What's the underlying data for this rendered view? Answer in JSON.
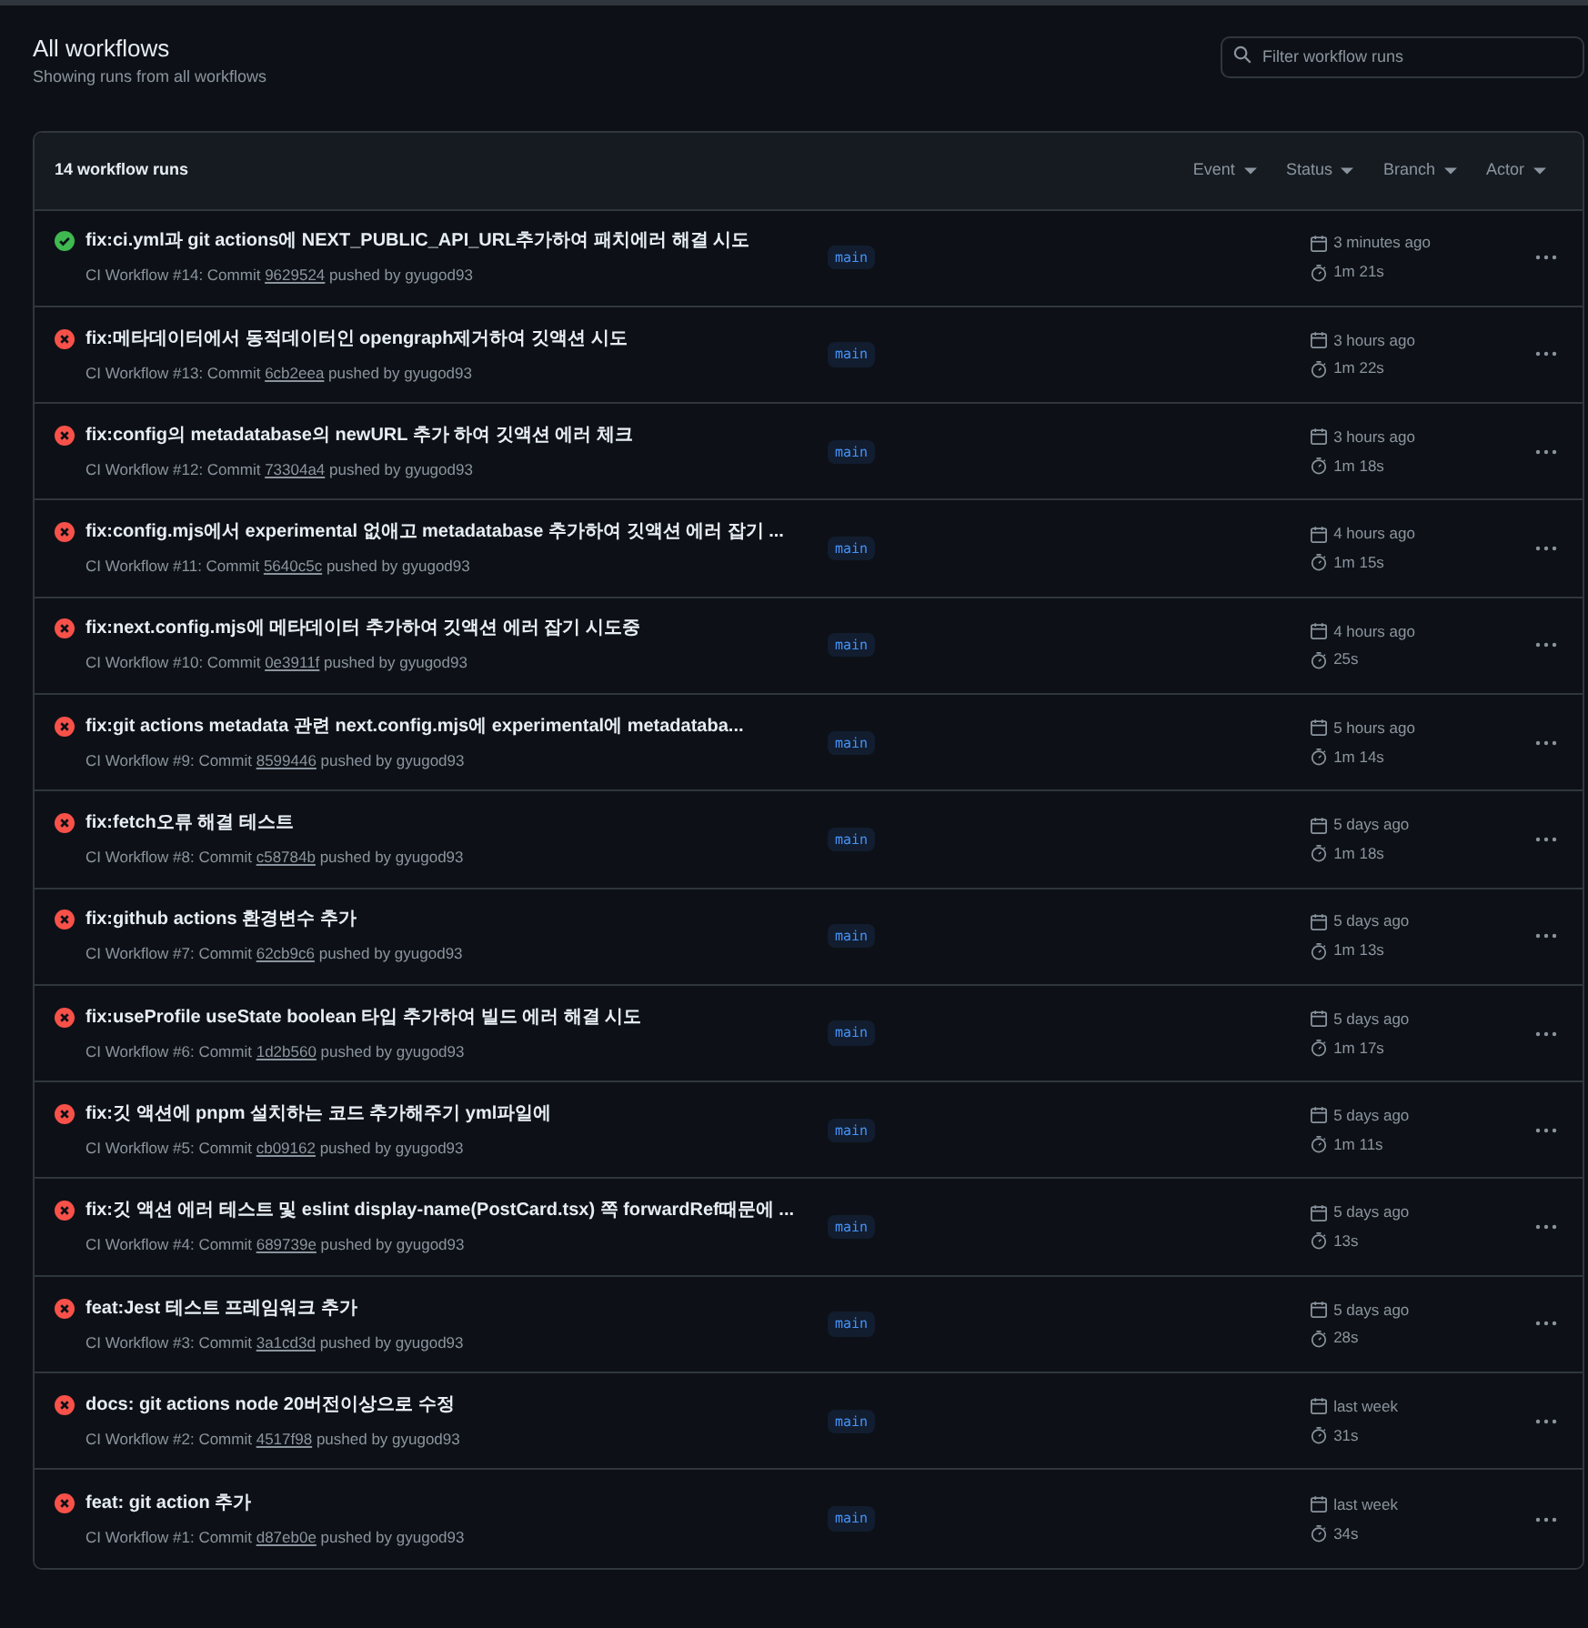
{
  "header": {
    "title": "All workflows",
    "subtitle": "Showing runs from all workflows"
  },
  "search": {
    "placeholder": "Filter workflow runs"
  },
  "runs_header": {
    "count": "14 workflow runs",
    "filters": [
      "Event",
      "Status",
      "Branch",
      "Actor"
    ]
  },
  "runs": [
    {
      "kind": "success",
      "title": "fix:ci.yml과 git actions에 NEXT_PUBLIC_API_URL추가하여 패치에러 해결 시도",
      "workflow": "CI Workflow #14: Commit ",
      "commit": "9629524",
      "actor": " pushed by gyugod93",
      "branch": "main",
      "time": "3 minutes ago",
      "duration": "1m 21s"
    },
    {
      "kind": "failure",
      "title": "fix:메타데이터에서 동적데이터인 opengraph제거하여 깃액션 시도",
      "workflow": "CI Workflow #13: Commit ",
      "commit": "6cb2eea",
      "actor": " pushed by gyugod93",
      "branch": "main",
      "time": "3 hours ago",
      "duration": "1m 22s"
    },
    {
      "kind": "failure",
      "title": "fix:config의 metadatabase의 newURL 추가 하여 깃액션 에러 체크",
      "workflow": "CI Workflow #12: Commit ",
      "commit": "73304a4",
      "actor": " pushed by gyugod93",
      "branch": "main",
      "time": "3 hours ago",
      "duration": "1m 18s"
    },
    {
      "kind": "failure",
      "title": "fix:config.mjs에서 experimental 없애고 metadatabase 추가하여 깃액션 에러 잡기 ...",
      "workflow": "CI Workflow #11: Commit ",
      "commit": "5640c5c",
      "actor": " pushed by gyugod93",
      "branch": "main",
      "time": "4 hours ago",
      "duration": "1m 15s"
    },
    {
      "kind": "failure",
      "title": "fix:next.config.mjs에 메타데이터 추가하여 깃액션 에러 잡기 시도중",
      "workflow": "CI Workflow #10: Commit ",
      "commit": "0e3911f",
      "actor": " pushed by gyugod93",
      "branch": "main",
      "time": "4 hours ago",
      "duration": "25s"
    },
    {
      "kind": "failure",
      "title": "fix:git actions metadata 관련 next.config.mjs에 experimental에 metadataba...",
      "workflow": "CI Workflow #9: Commit ",
      "commit": "8599446",
      "actor": " pushed by gyugod93",
      "branch": "main",
      "time": "5 hours ago",
      "duration": "1m 14s"
    },
    {
      "kind": "failure",
      "title": "fix:fetch오류 해결 테스트",
      "workflow": "CI Workflow #8: Commit ",
      "commit": "c58784b",
      "actor": " pushed by gyugod93",
      "branch": "main",
      "time": "5 days ago",
      "duration": "1m 18s"
    },
    {
      "kind": "failure",
      "title": "fix:github actions 환경변수 추가",
      "workflow": "CI Workflow #7: Commit ",
      "commit": "62cb9c6",
      "actor": " pushed by gyugod93",
      "branch": "main",
      "time": "5 days ago",
      "duration": "1m 13s"
    },
    {
      "kind": "failure",
      "title": "fix:useProfile useState boolean 타입 추가하여 빌드 에러 해결 시도",
      "workflow": "CI Workflow #6: Commit ",
      "commit": "1d2b560",
      "actor": " pushed by gyugod93",
      "branch": "main",
      "time": "5 days ago",
      "duration": "1m 17s"
    },
    {
      "kind": "failure",
      "title": "fix:깃 액션에 pnpm 설치하는 코드 추가해주기 yml파일에",
      "workflow": "CI Workflow #5: Commit ",
      "commit": "cb09162",
      "actor": " pushed by gyugod93",
      "branch": "main",
      "time": "5 days ago",
      "duration": "1m 11s"
    },
    {
      "kind": "failure",
      "title": "fix:깃 액션 에러 테스트 및 eslint display-name(PostCard.tsx) 쪽 forwardRef때문에 ...",
      "workflow": "CI Workflow #4: Commit ",
      "commit": "689739e",
      "actor": " pushed by gyugod93",
      "branch": "main",
      "time": "5 days ago",
      "duration": "13s"
    },
    {
      "kind": "failure",
      "title": "feat:Jest 테스트 프레임워크 추가",
      "workflow": "CI Workflow #3: Commit ",
      "commit": "3a1cd3d",
      "actor": " pushed by gyugod93",
      "branch": "main",
      "time": "5 days ago",
      "duration": "28s"
    },
    {
      "kind": "failure",
      "title": "docs: git actions node 20버전이상으로 수정",
      "workflow": "CI Workflow #2: Commit ",
      "commit": "4517f98",
      "actor": " pushed by gyugod93",
      "branch": "main",
      "time": "last week",
      "duration": "31s"
    },
    {
      "kind": "failure",
      "title": "feat: git action 추가",
      "workflow": "CI Workflow #1: Commit ",
      "commit": "d87eb0e",
      "actor": " pushed by gyugod93",
      "branch": "main",
      "time": "last week",
      "duration": "34s"
    }
  ]
}
